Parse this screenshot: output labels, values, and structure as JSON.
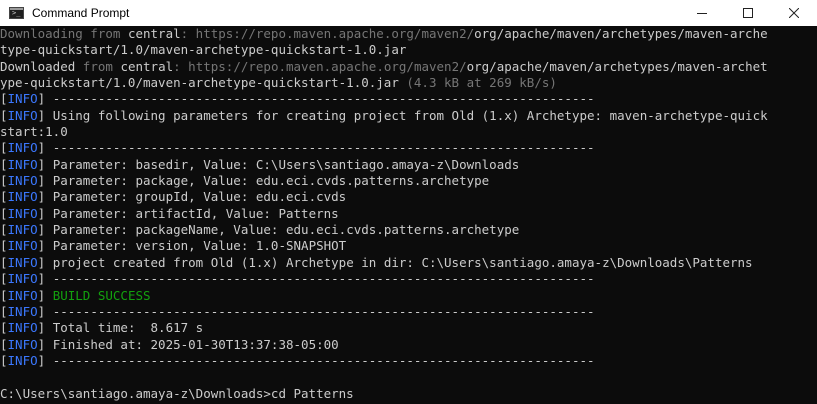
{
  "window": {
    "title": "Command Prompt",
    "icons": {
      "app": "cmd-icon",
      "minimize": "minimize-icon",
      "maximize": "maximize-icon",
      "close": "close-icon"
    }
  },
  "colors": {
    "background": "#0c0c0c",
    "text": "#cccccc",
    "dim": "#767676",
    "info_tag": "#3b78ff",
    "success": "#13a10e"
  },
  "console": {
    "lines": [
      [
        {
          "t": "Downloading from ",
          "c": "grey"
        },
        {
          "t": "central",
          "c": "white"
        },
        {
          "t": ": https://repo.maven.apache.org/maven2/",
          "c": "grey"
        },
        {
          "t": "org/apache/maven/archetypes/maven-arche",
          "c": "white"
        }
      ],
      [
        {
          "t": "type-quickstart/1.0/maven-archetype-quickstart-1.0.jar",
          "c": "white"
        }
      ],
      [
        {
          "t": "Downloaded ",
          "c": "white"
        },
        {
          "t": "from ",
          "c": "grey"
        },
        {
          "t": "central",
          "c": "white"
        },
        {
          "t": ": https://repo.maven.apache.org/maven2/",
          "c": "grey"
        },
        {
          "t": "org/apache/maven/archetypes/maven-archet",
          "c": "white"
        }
      ],
      [
        {
          "t": "ype-quickstart/1.0/maven-archetype-quickstart-1.0.jar",
          "c": "white"
        },
        {
          "t": " (4.3 kB at 269 kB/s)",
          "c": "grey"
        }
      ],
      [
        {
          "t": "[",
          "c": "white"
        },
        {
          "t": "INFO",
          "c": "blue"
        },
        {
          "t": "] ------------------------------------------------------------------------",
          "c": "white"
        }
      ],
      [
        {
          "t": "[",
          "c": "white"
        },
        {
          "t": "INFO",
          "c": "blue"
        },
        {
          "t": "] Using following parameters for creating project from Old (1.x) Archetype: maven-archetype-quick",
          "c": "white"
        }
      ],
      [
        {
          "t": "start:1.0",
          "c": "white"
        }
      ],
      [
        {
          "t": "[",
          "c": "white"
        },
        {
          "t": "INFO",
          "c": "blue"
        },
        {
          "t": "] ------------------------------------------------------------------------",
          "c": "white"
        }
      ],
      [
        {
          "t": "[",
          "c": "white"
        },
        {
          "t": "INFO",
          "c": "blue"
        },
        {
          "t": "] Parameter: basedir, Value: C:\\Users\\santiago.amaya-z\\Downloads",
          "c": "white"
        }
      ],
      [
        {
          "t": "[",
          "c": "white"
        },
        {
          "t": "INFO",
          "c": "blue"
        },
        {
          "t": "] Parameter: package, Value: edu.eci.cvds.patterns.archetype",
          "c": "white"
        }
      ],
      [
        {
          "t": "[",
          "c": "white"
        },
        {
          "t": "INFO",
          "c": "blue"
        },
        {
          "t": "] Parameter: groupId, Value: edu.eci.cvds",
          "c": "white"
        }
      ],
      [
        {
          "t": "[",
          "c": "white"
        },
        {
          "t": "INFO",
          "c": "blue"
        },
        {
          "t": "] Parameter: artifactId, Value: Patterns",
          "c": "white"
        }
      ],
      [
        {
          "t": "[",
          "c": "white"
        },
        {
          "t": "INFO",
          "c": "blue"
        },
        {
          "t": "] Parameter: packageName, Value: edu.eci.cvds.patterns.archetype",
          "c": "white"
        }
      ],
      [
        {
          "t": "[",
          "c": "white"
        },
        {
          "t": "INFO",
          "c": "blue"
        },
        {
          "t": "] Parameter: version, Value: 1.0-SNAPSHOT",
          "c": "white"
        }
      ],
      [
        {
          "t": "[",
          "c": "white"
        },
        {
          "t": "INFO",
          "c": "blue"
        },
        {
          "t": "] project created from Old (1.x) Archetype in dir: C:\\Users\\santiago.amaya-z\\Downloads\\Patterns",
          "c": "white"
        }
      ],
      [
        {
          "t": "[",
          "c": "white"
        },
        {
          "t": "INFO",
          "c": "blue"
        },
        {
          "t": "] ------------------------------------------------------------------------",
          "c": "white"
        }
      ],
      [
        {
          "t": "[",
          "c": "white"
        },
        {
          "t": "INFO",
          "c": "blue"
        },
        {
          "t": "] ",
          "c": "white"
        },
        {
          "t": "BUILD SUCCESS",
          "c": "green"
        }
      ],
      [
        {
          "t": "[",
          "c": "white"
        },
        {
          "t": "INFO",
          "c": "blue"
        },
        {
          "t": "] ------------------------------------------------------------------------",
          "c": "white"
        }
      ],
      [
        {
          "t": "[",
          "c": "white"
        },
        {
          "t": "INFO",
          "c": "blue"
        },
        {
          "t": "] Total time:  8.617 s",
          "c": "white"
        }
      ],
      [
        {
          "t": "[",
          "c": "white"
        },
        {
          "t": "INFO",
          "c": "blue"
        },
        {
          "t": "] Finished at: 2025-01-30T13:37:38-05:00",
          "c": "white"
        }
      ],
      [
        {
          "t": "[",
          "c": "white"
        },
        {
          "t": "INFO",
          "c": "blue"
        },
        {
          "t": "] ------------------------------------------------------------------------",
          "c": "white"
        }
      ],
      [],
      [
        {
          "t": "C:\\Users\\santiago.amaya-z\\Downloads>cd Patterns",
          "c": "white"
        }
      ]
    ]
  }
}
